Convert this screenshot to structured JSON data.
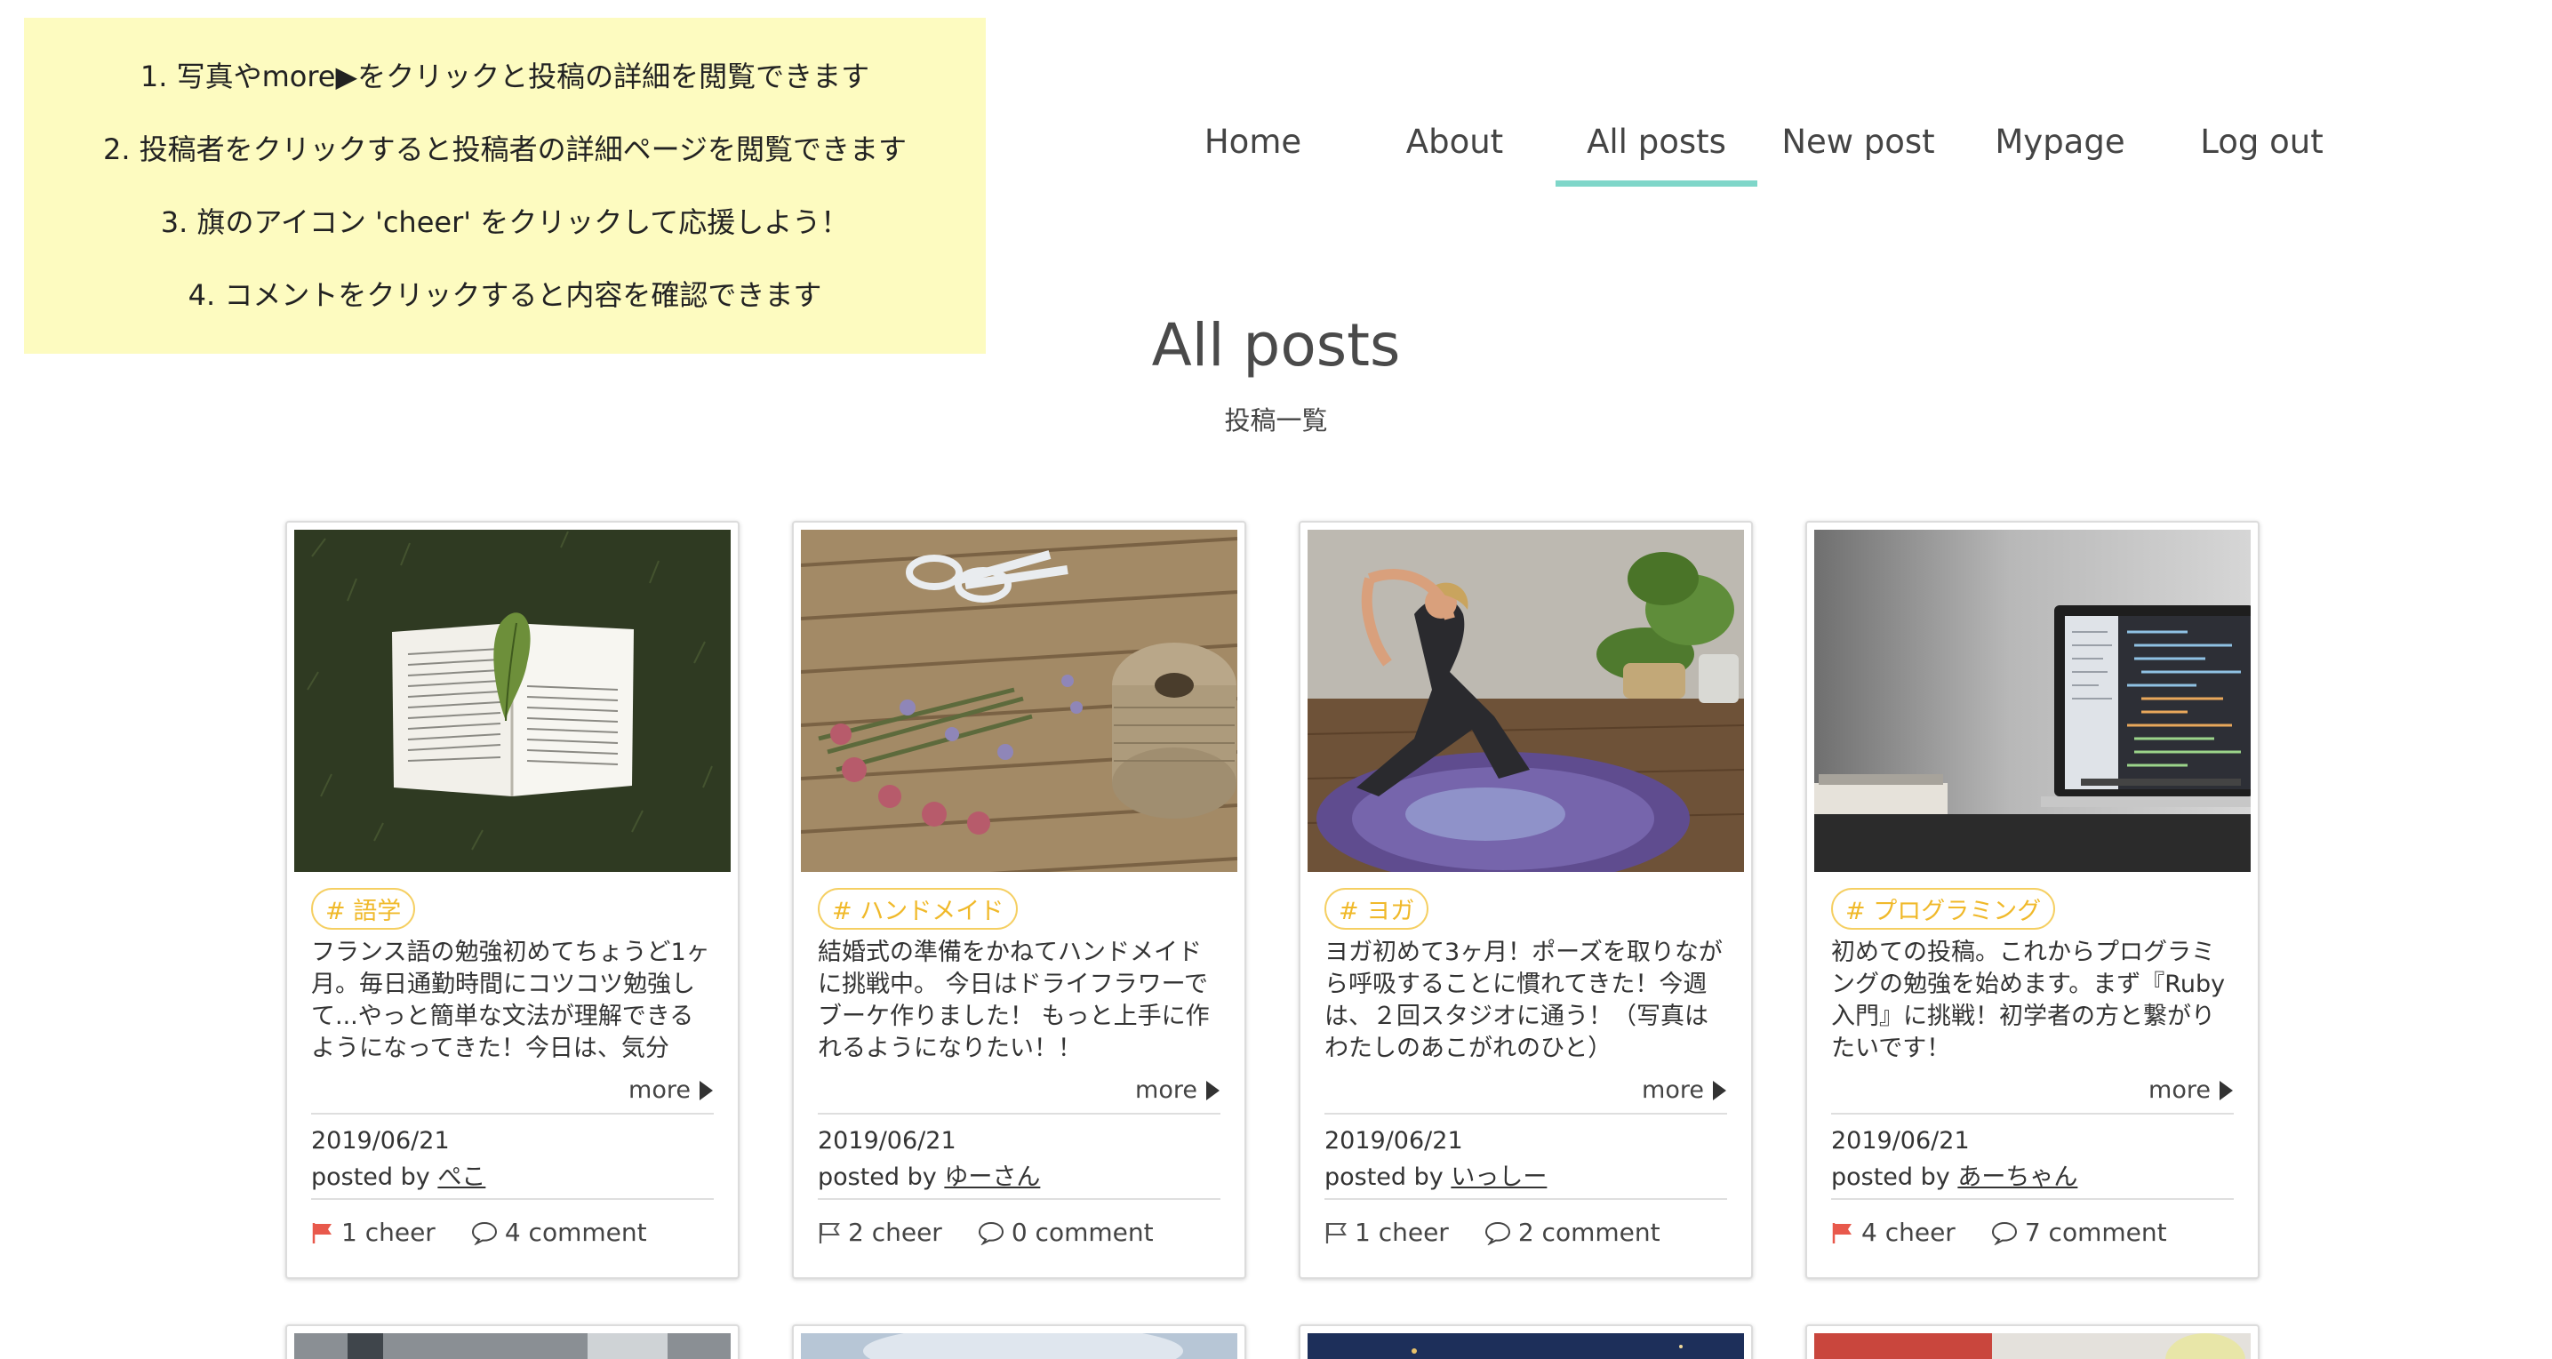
{
  "help": {
    "lines": [
      "1. 写真やmore▶をクリックと投稿の詳細を閲覧できます",
      "2. 投稿者をクリックすると投稿者の詳細ページを閲覧できます",
      "3. 旗のアイコン 'cheer' をクリックして応援しよう！",
      "4. コメントをクリックすると内容を確認できます"
    ]
  },
  "nav": {
    "items": [
      {
        "label": "Home"
      },
      {
        "label": "About"
      },
      {
        "label": "All posts",
        "active": true
      },
      {
        "label": "New post"
      },
      {
        "label": "Mypage"
      },
      {
        "label": "Log out"
      }
    ],
    "active_color": "#7fd6c9"
  },
  "page": {
    "title": "All posts",
    "subtitle": "投稿一覧"
  },
  "colors": {
    "tag": "#f0b92a",
    "cheer_flag_active": "#e8594c",
    "help_background": "#fdfbc0"
  },
  "posts": [
    {
      "tag": "# 語学",
      "excerpt": "フランス語の勉強初めてちょうど1ヶ月。毎日通勤時間にコツコツ勉強して...やっと簡単な文法が理解できるようになってきた！今日は、気分転...",
      "more": "more",
      "date": "2019/06/21",
      "posted_by": "posted by",
      "author": "ぺこ",
      "cheer": "1 cheer",
      "cheered": true,
      "comment": "4 comment",
      "image": "book-on-grass"
    },
    {
      "tag": "# ハンドメイド",
      "excerpt": "結婚式の準備をかねてハンドメイドに挑戦中。 今日はドライフラワーでブーケ作りました！ もっと上手に作れるようになりたい！！",
      "more": "more",
      "date": "2019/06/21",
      "posted_by": "posted by",
      "author": "ゆーさん",
      "cheer": "2 cheer",
      "cheered": false,
      "comment": "0 comment",
      "image": "dried-flowers-twine-scissors"
    },
    {
      "tag": "# ヨガ",
      "excerpt": "ヨガ初めて3ヶ月！ポーズを取りながら呼吸することに慣れてきた！今週は、２回スタジオに通う！（写真はわたしのあこがれのひと）",
      "more": "more",
      "date": "2019/06/21",
      "posted_by": "posted by",
      "author": "いっしー",
      "cheer": "1 cheer",
      "cheered": false,
      "comment": "2 comment",
      "image": "yoga-pose-on-mat"
    },
    {
      "tag": "# プログラミング",
      "excerpt": "初めての投稿。これからプログラミングの勉強を始めます。まず『Ruby入門』に挑戦！初学者の方と繋がりたいです！",
      "more": "more",
      "date": "2019/06/21",
      "posted_by": "posted by",
      "author": "あーちゃん",
      "cheer": "4 cheer",
      "cheered": true,
      "comment": "7 comment",
      "image": "laptop-with-code"
    }
  ]
}
